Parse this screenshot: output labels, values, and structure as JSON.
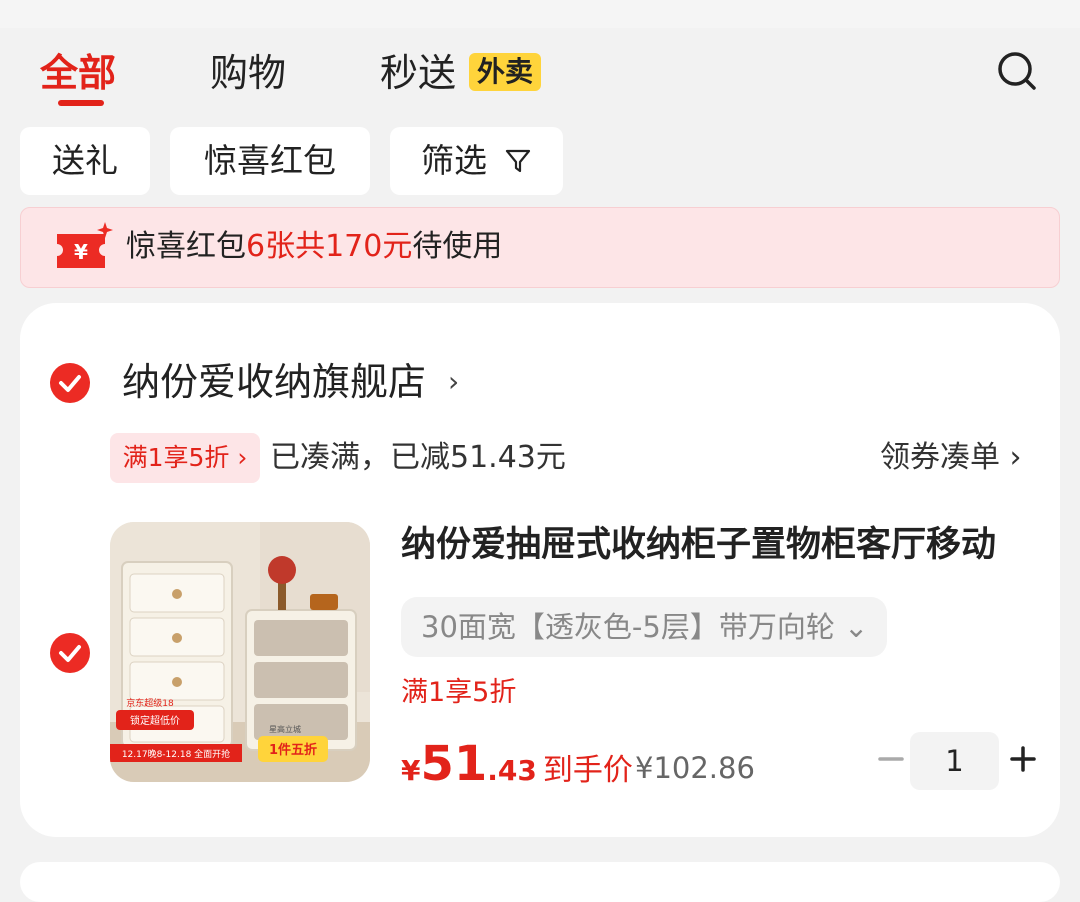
{
  "tabs": [
    {
      "label": "全部",
      "active": true
    },
    {
      "label": "购物",
      "active": false
    },
    {
      "label": "秒送",
      "active": false
    }
  ],
  "waimai_badge": "外卖",
  "filters": [
    "送礼",
    "惊喜红包",
    "筛选"
  ],
  "coupon_banner": {
    "prefix": "惊喜红包",
    "highlight": "6张共170元",
    "suffix": "待使用"
  },
  "store": {
    "name": "纳份爱收纳旗舰店",
    "chevron": "›",
    "promo_tag": "满1享5折 ›",
    "promo_text": "已凑满，已减51.43元",
    "coupon_collect": "领券凑单 ›"
  },
  "product": {
    "title": "纳份爱抽屉式收纳柜子置物柜客厅移动",
    "spec": "30面宽【透灰色-5层】带万向轮 ⌄",
    "promo": "满1享5折",
    "price_symbol": "¥",
    "price_int": "51",
    "price_dec": ".43",
    "price_label": "到手价",
    "original_price": "¥102.86",
    "quantity": "1",
    "image_badges": {
      "corner": "京东超级18",
      "lock": "锁定超低价",
      "time": "12.17晚8-12.18 全面开抢",
      "store_tag": "星高立城",
      "discount": "1件五折"
    }
  },
  "colors": {
    "accent": "#e2231a",
    "badge_yellow": "#ffd43b",
    "banner_bg": "#fde5e7"
  },
  "icons": [
    "search-icon",
    "filter-icon",
    "coupon-icon",
    "check-icon",
    "minus-icon",
    "plus-icon"
  ]
}
